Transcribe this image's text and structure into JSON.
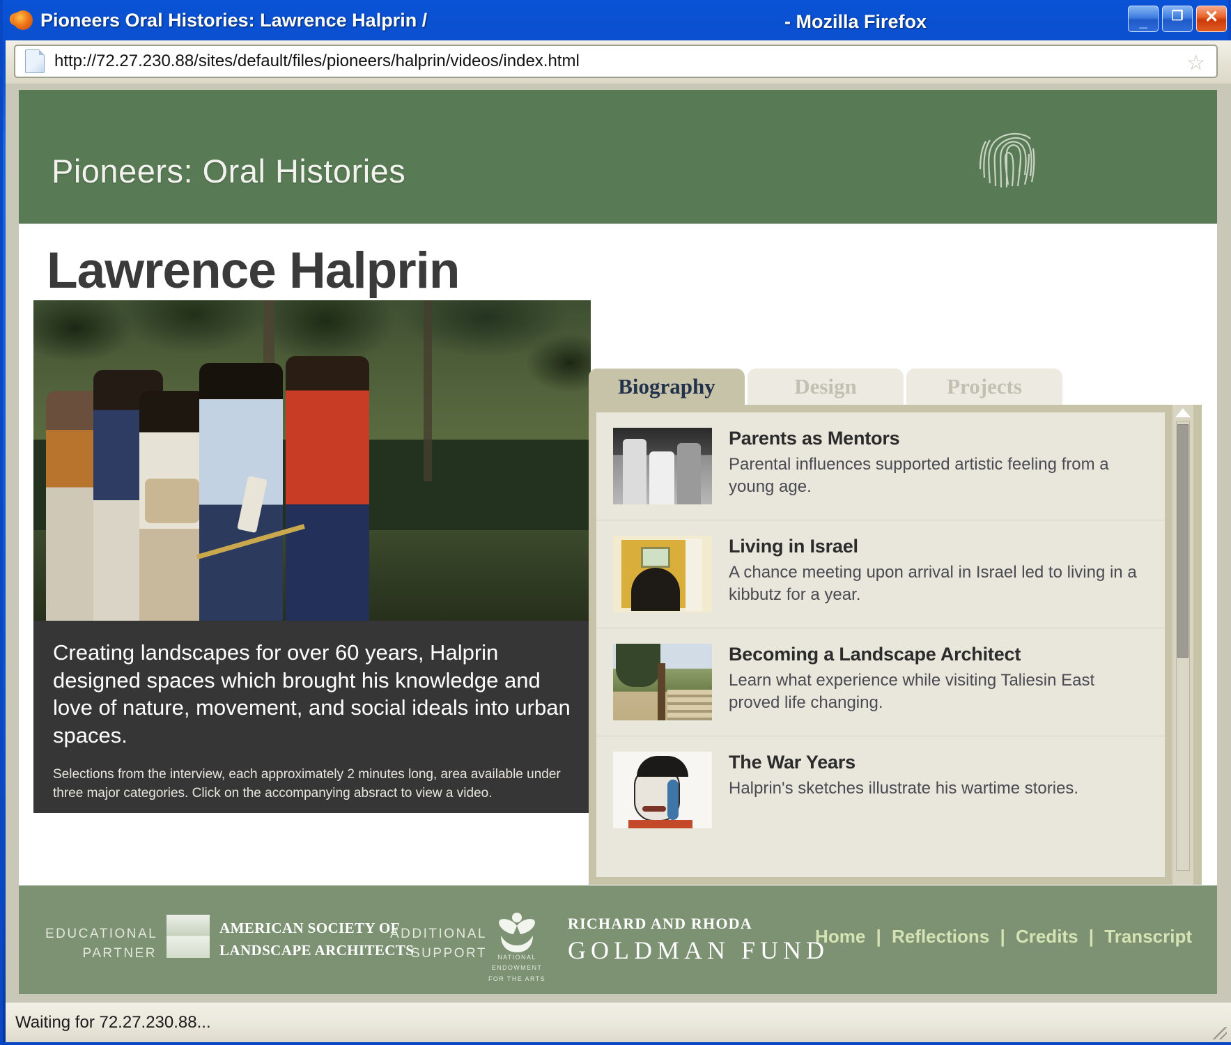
{
  "window": {
    "title": "Pioneers Oral Histories: Lawrence Halprin /",
    "title_suffix": "- Mozilla Firefox",
    "app_icon": "firefox-icon",
    "minimize_glyph": "_",
    "maximize_glyph": "❐",
    "close_glyph": "✕"
  },
  "toolbar": {
    "url": "http://72.27.230.88/sites/default/files/pioneers/halprin/videos/index.html",
    "page_icon": "document-icon",
    "bookmark_glyph": "☆"
  },
  "banner": {
    "site_title": "Pioneers: Oral Histories",
    "logo": "fingerprint-icon",
    "bg_color": "#587A54"
  },
  "page": {
    "title": "Lawrence Halprin"
  },
  "hero": {
    "caption_main": "Creating landscapes for over 60 years, Halprin designed spaces which brought his knowledge and love of nature, movement, and social ideals into urban spaces.",
    "caption_sub": "Selections from the interview, each approximately 2 minutes long, area available under three major categories. Click on the accompanying absract to view a video.",
    "caption_bg": "#363636"
  },
  "tabs": [
    {
      "label": "Biography",
      "active": true
    },
    {
      "label": "Design",
      "active": false
    },
    {
      "label": "Projects",
      "active": false
    }
  ],
  "entries": [
    {
      "title": "Parents as Mentors",
      "desc": "Parental influences supported artistic feeling from a young age.",
      "thumb": "family-photo-thumbnail"
    },
    {
      "title": "Living in Israel",
      "desc": "A chance meeting upon arrival in Israel led to living in a kibbutz for a year.",
      "thumb": "archway-sketch-thumbnail"
    },
    {
      "title": "Becoming a Landscape Architect",
      "desc": "Learn what experience while visiting Taliesin East proved life changing.",
      "thumb": "landscape-photo-thumbnail"
    },
    {
      "title": "The War Years",
      "desc": "Halprin's sketches illustrate his wartime stories.",
      "thumb": "portrait-sketch-thumbnail"
    }
  ],
  "footer": {
    "educational_partner": "EDUCATIONAL PARTNER",
    "asla_line1": "AMERICAN SOCIETY OF",
    "asla_line2": "LANDSCAPE ARCHITECTS",
    "additional_support": "ADDITIONAL SUPPORT",
    "nea_text": "NATIONAL ENDOWMENT FOR THE ARTS",
    "goldman_line1": "RICHARD AND RHODA",
    "goldman_line2": "GOLDMAN  FUND",
    "nav": [
      "Home",
      "Reflections",
      "Credits",
      "Transcript"
    ],
    "nav_separator": "|",
    "bg_color": "#7C9273",
    "link_color": "#D5E2B4"
  },
  "status": {
    "text": "Waiting for 72.27.230.88..."
  }
}
